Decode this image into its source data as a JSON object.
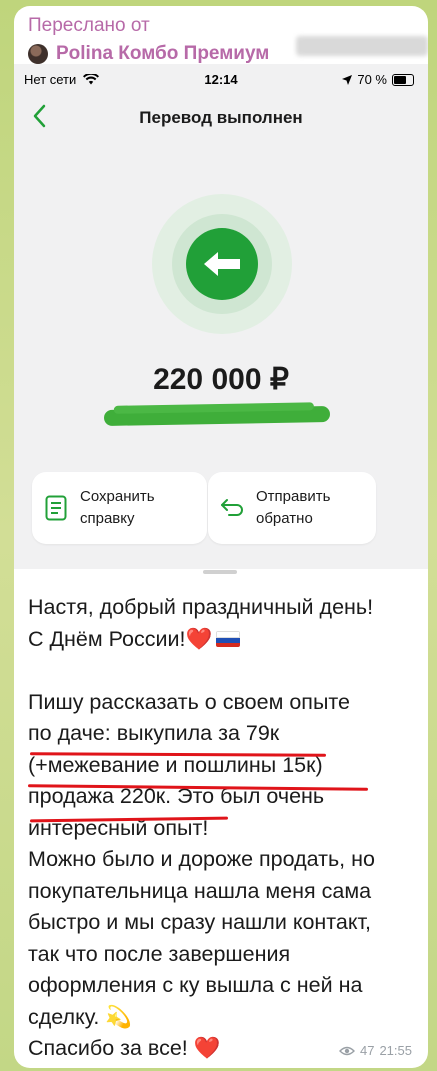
{
  "forward": {
    "label": "Переслано от",
    "name": "Polina Комбо Премиум"
  },
  "status_bar": {
    "carrier": "Нет сети",
    "time": "12:14",
    "battery": "70 %"
  },
  "screen": {
    "title": "Перевод выполнен",
    "amount": "220 000 ₽",
    "actions": [
      {
        "label_line1": "Сохранить",
        "label_line2": "справку",
        "icon": "document-icon"
      },
      {
        "label_line1": "Отправить",
        "label_line2": "обратно",
        "icon": "return-arrow-icon"
      }
    ]
  },
  "message": {
    "line1": "Настя, добрый праздничный день!",
    "line2": "С Днём России!❤️",
    "line3": "Пишу рассказать о своем опыте",
    "line4": "по даче: выкупила за 79к",
    "line5": "(+межевание и пошлины 15к)",
    "line6": "продажа 220к. Это был очень",
    "line7": "интересный опыт!",
    "line8": "Можно было и дороже продать, но",
    "line9": "покупательница нашла меня сама",
    "line10": "быстро и мы сразу нашли контакт,",
    "line11": "так что после завершения",
    "line12": "оформления с ку вышла с ней на",
    "line13": "сделку. 💫",
    "line14": "Спасибо за все! ❤️"
  },
  "meta": {
    "views": "47",
    "time": "21:55"
  },
  "colors": {
    "accent_green": "#21a038",
    "forward_pink": "#b76aa8",
    "underline_red": "#e0141a"
  }
}
